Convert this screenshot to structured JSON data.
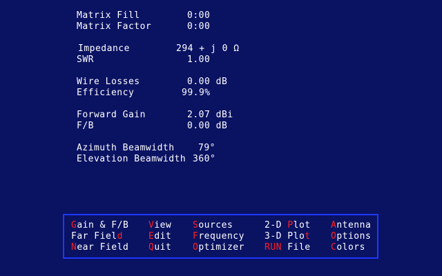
{
  "results": {
    "matrix_fill_label": "Matrix Fill",
    "matrix_fill_value": "0:00",
    "matrix_factor_label": "Matrix Factor",
    "matrix_factor_value": "0:00",
    "impedance_label": "Impedance",
    "impedance_value": "294 + j 0 Ω",
    "swr_label": "SWR",
    "swr_value": "1.00",
    "wire_losses_label": "Wire Losses",
    "wire_losses_value": "0.00 dB",
    "efficiency_label": "Efficiency",
    "efficiency_value": "99.9%",
    "forward_gain_label": "Forward Gain",
    "forward_gain_value": "2.07 dBi",
    "fb_label": "F/B",
    "fb_value": "0.00 dB",
    "azimuth_bw_label": "Azimuth Beamwidth",
    "azimuth_bw_value": "79°",
    "elevation_bw_label": "Elevation Beamwidth",
    "elevation_bw_value": "360°"
  },
  "menu": {
    "gain_fb": {
      "hot": "G",
      "rest": "ain & F/B"
    },
    "far_field": {
      "pre": "Far Fiel",
      "hot": "d"
    },
    "near_field": {
      "hot": "N",
      "rest": "ear Field"
    },
    "view": {
      "hot": "V",
      "rest": "iew"
    },
    "edit": {
      "hot": "E",
      "rest": "dit"
    },
    "quit": {
      "hot": "Q",
      "rest": "uit"
    },
    "sources": {
      "hot": "S",
      "rest": "ources"
    },
    "frequency": {
      "hot": "F",
      "rest": "requency"
    },
    "optimizer": {
      "hot": "O",
      "rest": "ptimizer"
    },
    "plot_2d": {
      "pre": "2-D ",
      "hot": "P",
      "rest": "lot"
    },
    "plot_3d": {
      "pre": "3-D Plo",
      "hot": "t"
    },
    "run_file": {
      "hot": "RUN",
      "rest": " File"
    },
    "antenna": {
      "hot": "A",
      "rest": "ntenna"
    },
    "options": {
      "hot": "O",
      "rest": "ptions"
    },
    "colors": {
      "hot": "C",
      "rest": "olors"
    }
  },
  "colors": {
    "background": "#0a1262",
    "text": "#ffffff",
    "hotkey": "#ff2020",
    "menu_border": "#1e38ff"
  }
}
